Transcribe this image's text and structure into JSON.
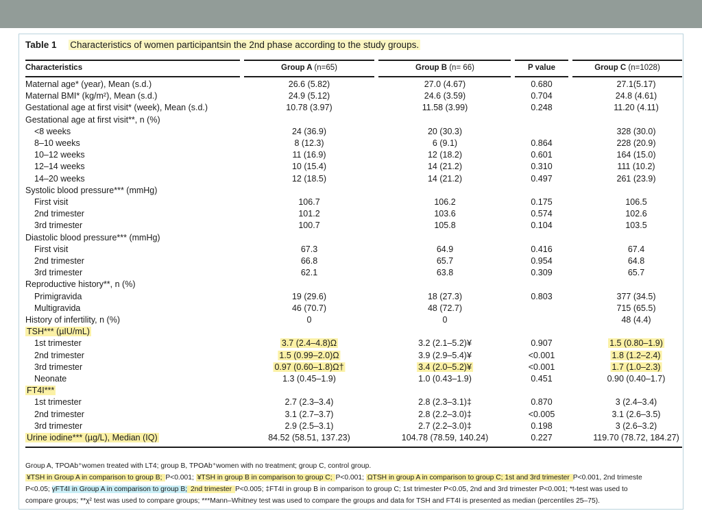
{
  "table": {
    "label": "Table 1",
    "title": "Characteristics of women participantsin the 2nd phase according to the study groups.",
    "headers": {
      "characteristics": "Characteristics",
      "group_a": "Group A",
      "group_a_n": "(n=65)",
      "group_b": "Group B",
      "group_b_n": "(n= 66)",
      "p_value": "P value",
      "group_c": "Group C",
      "group_c_n": "(n=1028)"
    },
    "rows": [
      {
        "label": "Maternal age* (year), Mean (s.d.)",
        "a": "26.6 (5.82)",
        "b": "27.0 (4.67)",
        "p": "0.680",
        "c": "27.1(5.17)",
        "indent": false
      },
      {
        "label": "Maternal BMI* (kg/m²), Mean (s.d.)",
        "a": "24.9 (5.12)",
        "b": "24.6 (3.59)",
        "p": "0.704",
        "c": "24.8 (4.61)",
        "indent": false
      },
      {
        "label": "Gestational age at first visit* (week), Mean (s.d.)",
        "a": "10.78 (3.97)",
        "b": "11.58 (3.99)",
        "p": "0.248",
        "c": "11.20 (4.11)",
        "indent": false
      },
      {
        "label": "Gestational age at first visit**, n (%)",
        "a": "",
        "b": "",
        "p": "",
        "c": "",
        "indent": false
      },
      {
        "label": "<8 weeks",
        "a": "24 (36.9)",
        "b": "20 (30.3)",
        "p": "",
        "c": "328 (30.0)",
        "indent": true
      },
      {
        "label": "8–10 weeks",
        "a": "8 (12.3)",
        "b": "6 (9.1)",
        "p": "0.864",
        "c": "228 (20.9)",
        "indent": true
      },
      {
        "label": "10–12 weeks",
        "a": "11 (16.9)",
        "b": "12 (18.2)",
        "p": "0.601",
        "c": "164 (15.0)",
        "indent": true
      },
      {
        "label": "12–14 weeks",
        "a": "10 (15.4)",
        "b": "14 (21.2)",
        "p": "0.310",
        "c": "111 (10.2)",
        "indent": true
      },
      {
        "label": "14–20 weeks",
        "a": "12 (18.5)",
        "b": "14 (21.2)",
        "p": "0.497",
        "c": "261 (23.9)",
        "indent": true
      },
      {
        "label": "Systolic blood pressure*** (mmHg)",
        "a": "",
        "b": "",
        "p": "",
        "c": "",
        "indent": false
      },
      {
        "label": "First visit",
        "a": "106.7",
        "b": "106.2",
        "p": "0.175",
        "c": "106.5",
        "indent": true
      },
      {
        "label": "2nd trimester",
        "a": "101.2",
        "b": "103.6",
        "p": "0.574",
        "c": "102.6",
        "indent": true
      },
      {
        "label": "3rd trimester",
        "a": "100.7",
        "b": "105.8",
        "p": "0.104",
        "c": "103.5",
        "indent": true
      },
      {
        "label": "Diastolic blood pressure*** (mmHg)",
        "a": "",
        "b": "",
        "p": "",
        "c": "",
        "indent": false
      },
      {
        "label": "First visit",
        "a": "67.3",
        "b": "64.9",
        "p": "0.416",
        "c": "67.4",
        "indent": true
      },
      {
        "label": "2nd trimester",
        "a": "66.8",
        "b": "65.7",
        "p": "0.954",
        "c": "64.8",
        "indent": true
      },
      {
        "label": "3rd trimester",
        "a": "62.1",
        "b": "63.8",
        "p": "0.309",
        "c": "65.7",
        "indent": true
      },
      {
        "label": "Reproductive history**, n (%)",
        "a": "",
        "b": "",
        "p": "",
        "c": "",
        "indent": false
      },
      {
        "label": "Primigravida",
        "a": "19 (29.6)",
        "b": "18 (27.3)",
        "p": "0.803",
        "c": "377 (34.5)",
        "indent": true
      },
      {
        "label": "Multigravida",
        "a": "46 (70.7)",
        "b": "48 (72.7)",
        "p": "",
        "c": "715 (65.5)",
        "indent": true
      },
      {
        "label": "History of infertility, n (%)",
        "a": "0",
        "b": "0",
        "p": "",
        "c": "48 (4.4)",
        "indent": false
      },
      {
        "label": "TSH*** (µIU/mL)",
        "a": "",
        "b": "",
        "p": "",
        "c": "",
        "indent": false,
        "hl_label": true
      },
      {
        "label": "1st trimester",
        "a": "3.7 (2.4–4.8)Ω",
        "b": "3.2 (2.1–5.2)¥",
        "p": "0.907",
        "c": "1.5 (0.80–1.9)",
        "indent": true,
        "hl_a": true,
        "hl_c": true
      },
      {
        "label": "2nd trimester",
        "a": "1.5 (0.99–2.0)Ω",
        "b": "3.9 (2.9–5.4)¥",
        "p": "<0.001",
        "c": "1.8 (1.2–2.4)",
        "indent": true,
        "hl_a": true,
        "hl_c": true
      },
      {
        "label": "3rd trimester",
        "a": "0.97 (0.60–1.8)Ω†",
        "b": "3.4 (2.0–5.2)¥",
        "p": "<0.001",
        "c": "1.7 (1.0–2.3)",
        "indent": true,
        "hl_a": true,
        "hl_b": true,
        "hl_c": true
      },
      {
        "label": "Neonate",
        "a": "1.3 (0.45–1.9)",
        "b": "1.0 (0.43–1.9)",
        "p": "0.451",
        "c": "0.90 (0.40–1.7)",
        "indent": true
      },
      {
        "label": "FT4I***",
        "a": "",
        "b": "",
        "p": "",
        "c": "",
        "indent": false,
        "hl_label": true
      },
      {
        "label": "1st trimester",
        "a": "2.7 (2.3–3.4)",
        "b": "2.8 (2.3–3.1)‡",
        "p": "0.870",
        "c": "3 (2.4–3.4)",
        "indent": true
      },
      {
        "label": "2nd trimester",
        "a": "3.1 (2.7–3.7)",
        "b": "2.8 (2.2–3.0)‡",
        "p": "<0.005",
        "c": "3.1 (2.6–3.5)",
        "indent": true
      },
      {
        "label": "3rd trimester",
        "a": "2.9 (2.5–3.1)",
        "b": "2.7 (2.2–3.0)‡",
        "p": "0.198",
        "c": "3 (2.6–3.2)",
        "indent": true
      },
      {
        "label": "Urine iodine*** (µg/L), Median (IQ)",
        "a": "84.52 (58.51, 137.23)",
        "b": "104.78 (78.59, 140.24)",
        "p": "0.227",
        "c": "119.70 (78.72, 184.27)",
        "indent": false,
        "hl_label": true
      }
    ],
    "notes": {
      "line1": "Group A, TPOAb⁺women treated with LT4; group B, TPOAb⁺women with no treatment; group C, control group.",
      "line2a": "¥TSH in Group A in comparison to group B; ",
      "line2b": "P<0.001; ",
      "line2c": "¥TSH in group B in comparison to group C; ",
      "line2d": "P<0.001; ",
      "line2e": "ΩTSH in group A in comparison to group C; 1st and 3rd trimester ",
      "line2f": "P<0.001, 2nd trimeste",
      "line3a": "P<0.05; ",
      "line3b": "γFT4I in Group A in comparison to group B;",
      "line3c": " 2nd trimester ",
      "line3d": "P<0.005;  ‡FT4I in group B in comparison to group C; 1st trimester P<0.05, 2nd and 3rd trimester P<0.001; *t-test was used to",
      "line4": "compare groups; **χ² test was used to compare groups; ***Mann–Whitney test was used to compare the groups and data for TSH and FT4I is presented as median (percentiles 25–75)."
    }
  }
}
